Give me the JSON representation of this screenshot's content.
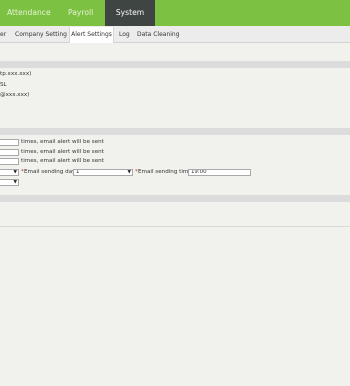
{
  "topnav": {
    "items": [
      {
        "label": "Attendance"
      },
      {
        "label": "Payroll"
      },
      {
        "label": "System"
      }
    ]
  },
  "subnav": {
    "tabs": [
      {
        "label": "er"
      },
      {
        "label": "Company Setting"
      },
      {
        "label": "Alert Settings"
      },
      {
        "label": "Log"
      },
      {
        "label": "Data Cleaning"
      }
    ]
  },
  "email_section": {
    "lines": [
      "tp.xxx.xxx)",
      "SL",
      "@xxx.xxx)"
    ]
  },
  "alert_section": {
    "rows": [
      {
        "suffix": "times, email alert will be sent",
        "value": ""
      },
      {
        "suffix": "times, email alert will be sent",
        "value": ""
      },
      {
        "suffix": "times, email alert will be sent",
        "value": ""
      }
    ],
    "sending_day_label": "Email sending day:",
    "sending_day_value": "1",
    "sending_time_label": "Email sending time:",
    "sending_time_value": "19:00",
    "asterisk": "*"
  }
}
